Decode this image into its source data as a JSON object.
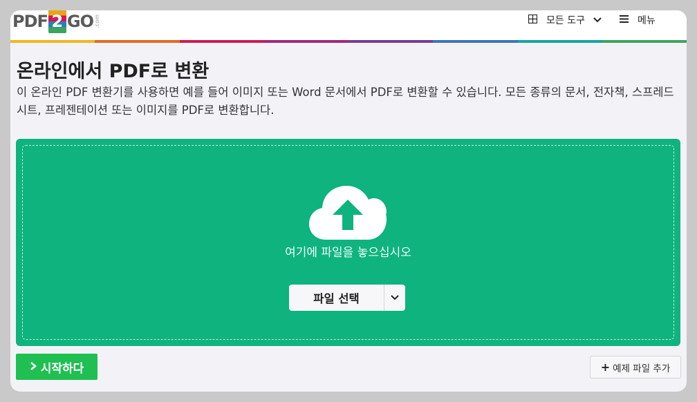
{
  "header": {
    "logo": {
      "left": "PDF",
      "mid": "2",
      "right": "GO",
      "suffix": ".com"
    },
    "tools_label": "모든 도구",
    "menu_label": "메뉴"
  },
  "brand_stripe_colors": [
    "#f2b51c",
    "#e8681f",
    "#d21a4f",
    "#a1287e",
    "#7a3b92",
    "#3a75b8",
    "#14a4a0",
    "#3aa55c"
  ],
  "main": {
    "title": "온라인에서 PDF로 변환",
    "description": "이 온라인 PDF 변환기를 사용하면 예를 들어 이미지 또는 Word 문서에서 PDF로 변환할 수 있습니다. 모든 종류의 문서, 전자책, 스프레드시트, 프레젠테이션 또는 이미지를 PDF로 변환합니다.",
    "dropzone": {
      "drop_text": "여기에 파일을 놓으십시오",
      "choose_label": "파일 선택",
      "bg_color": "#0fb37d"
    },
    "start_label": "시작하다",
    "start_color": "#1fbf52",
    "example_label": "예제 파일 추가"
  }
}
